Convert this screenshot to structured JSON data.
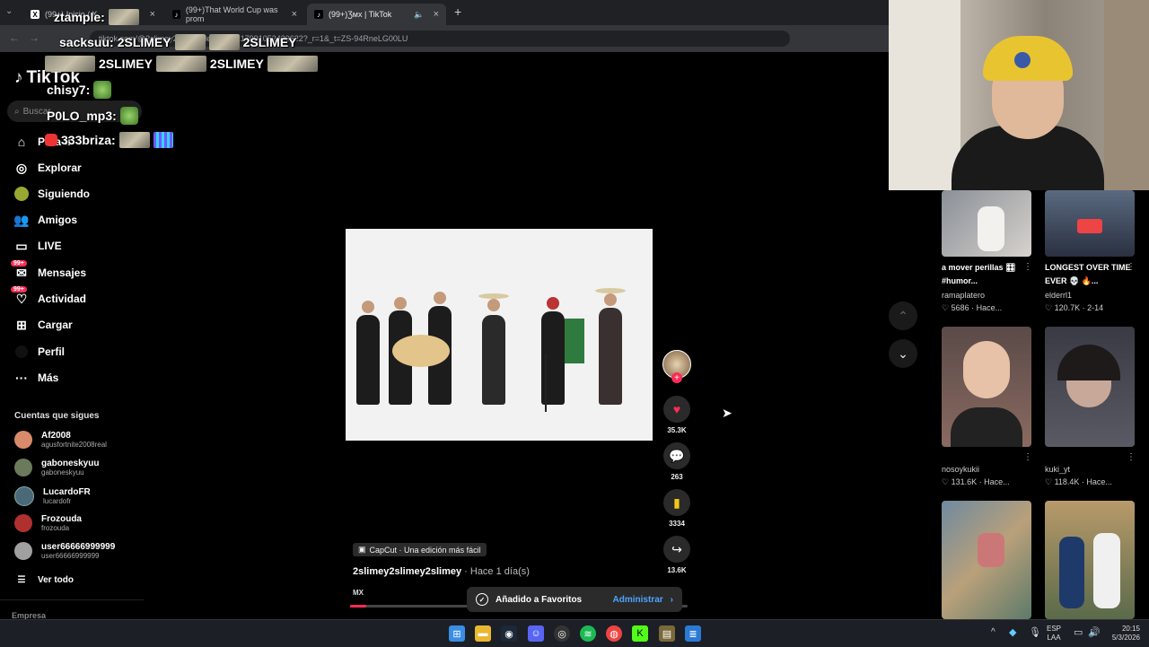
{
  "browser": {
    "tabs": [
      {
        "label": "(99+) Inicio / X",
        "favicon": "X"
      },
      {
        "label": "(99+)That World Cup was prom",
        "favicon": "♪"
      },
      {
        "label": "(99+)Ʒмx | TikTok",
        "favicon": "♪"
      }
    ],
    "url": "tiktok.com/@2slimey2sli... /video/7614217991052430622?_r=1&_t=ZS-94RneLG00LU"
  },
  "chat": [
    {
      "user": "ztample:"
    },
    {
      "user": "sacksuu:",
      "message": "2SLIMEY"
    },
    {
      "message": "2SLIMEY"
    },
    {
      "message": "2SLIMEY"
    },
    {
      "message": "2SLIMEY"
    },
    {
      "message": "2SLIMEY"
    },
    {
      "user": "chisy7:"
    },
    {
      "user": "P0LO_mp3:"
    },
    {
      "user": "333briza:"
    }
  ],
  "sidebar": {
    "logo": "TikTok",
    "search_placeholder": "Buscar",
    "items": [
      {
        "label": "Para ti",
        "icon": "home-icon"
      },
      {
        "label": "Explorar",
        "icon": "compass-icon"
      },
      {
        "label": "Siguiendo",
        "icon": "following-icon"
      },
      {
        "label": "Amigos",
        "icon": "friends-icon"
      },
      {
        "label": "LIVE",
        "icon": "live-icon"
      },
      {
        "label": "Mensajes",
        "icon": "messages-icon",
        "badge": "99+"
      },
      {
        "label": "Actividad",
        "icon": "activity-icon",
        "badge": "99+"
      },
      {
        "label": "Cargar",
        "icon": "upload-icon"
      },
      {
        "label": "Perfil",
        "icon": "profile-icon"
      },
      {
        "label": "Más",
        "icon": "more-icon"
      }
    ],
    "following_title": "Cuentas que sigues",
    "following": [
      {
        "name": "Af2008",
        "handle": "agusfortnite2008real",
        "color": "#d98a6b"
      },
      {
        "name": "gaboneskyuu",
        "handle": "gaboneskyuu",
        "color": "#6b7a5a"
      },
      {
        "name": "LucardoFR",
        "handle": "lucardofr",
        "color": "#4a6a7a"
      },
      {
        "name": "Frozouda",
        "handle": "frozouda",
        "color": "#b03030"
      },
      {
        "name": "user66666999999",
        "handle": "user66666999999",
        "color": "#a0a0a0"
      }
    ],
    "see_all": "Ver todo",
    "footer": "Empresa"
  },
  "video": {
    "capcut": "CapCut · Una edición más fácil",
    "author": "2slimey2slimey2slimey",
    "time": "· Hace 1 día(s)",
    "music": "MX",
    "likes": "35.3K",
    "comments": "263",
    "saves": "3334",
    "shares": "13.6K"
  },
  "toast": {
    "text": "Añadido a Favoritos",
    "action": "Administrar"
  },
  "suggestions": [
    {
      "title": "a mover perillas 🎛 #humor...",
      "user": "ramaplatero",
      "stats": "♡ 5686 · Hace..."
    },
    {
      "title": "LONGEST OVER TIME EVER 💀 🔥...",
      "user": "elderrl1",
      "stats": "♡ 120.7K · 2-14"
    },
    {
      "title": "",
      "user": "nosoykukii",
      "stats": "♡ 131.6K · Hace..."
    },
    {
      "title": "",
      "user": "kuki_yt",
      "stats": "♡ 118.4K · Hace..."
    }
  ],
  "taskbar": {
    "lang_top": "ESP",
    "lang_bottom": "LAA",
    "time": "20:15",
    "date": "5/3/2026"
  },
  "colors": {
    "accent": "#fe2c55",
    "bg": "#000000",
    "toast_link": "#4ea3ff"
  }
}
